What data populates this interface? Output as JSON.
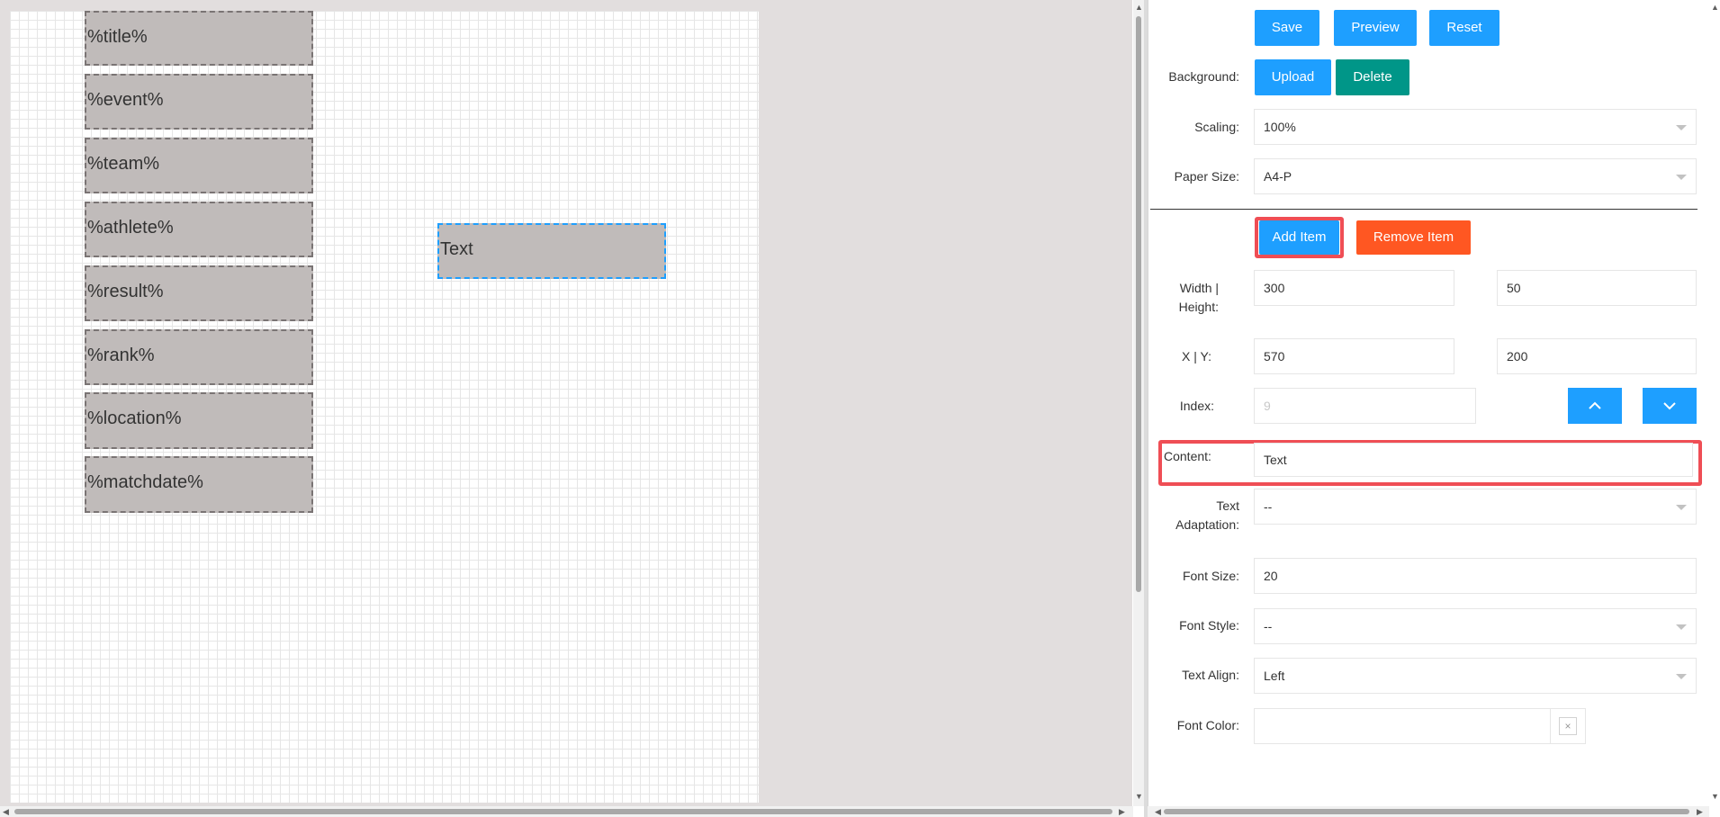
{
  "canvas": {
    "items": [
      "%title%",
      "%event%",
      "%team%",
      "%athlete%",
      "%result%",
      "%rank%",
      "%location%",
      "%matchdate%"
    ],
    "selected_item_text": "Text"
  },
  "toolbar": {
    "save_label": "Save",
    "preview_label": "Preview",
    "reset_label": "Reset"
  },
  "background": {
    "label": "Background:",
    "upload_label": "Upload",
    "delete_label": "Delete"
  },
  "scaling": {
    "label": "Scaling:",
    "value": "100%"
  },
  "paper_size": {
    "label": "Paper Size:",
    "value": "A4-P"
  },
  "item_actions": {
    "add_label": "Add Item",
    "remove_label": "Remove Item"
  },
  "size": {
    "label_line1": "Width |",
    "label_line2": "Height:",
    "width": "300",
    "height": "50"
  },
  "position": {
    "label": "X | Y:",
    "x": "570",
    "y": "200"
  },
  "index": {
    "label": "Index:",
    "placeholder": "9"
  },
  "content": {
    "label": "Content:",
    "value": "Text"
  },
  "text_adaptation": {
    "label_line1": "Text",
    "label_line2": "Adaptation:",
    "value": "--"
  },
  "font_size": {
    "label": "Font Size:",
    "value": "20"
  },
  "font_style": {
    "label": "Font Style:",
    "value": "--"
  },
  "text_align": {
    "label": "Text Align:",
    "value": "Left"
  },
  "font_color": {
    "label": "Font Color:",
    "value": "",
    "clear_glyph": "×"
  },
  "colors": {
    "accent": "#1e9fff",
    "teal": "#009688",
    "orange": "#ff5722",
    "highlight": "#ef4e55",
    "item_fill": "#c0bbba"
  }
}
